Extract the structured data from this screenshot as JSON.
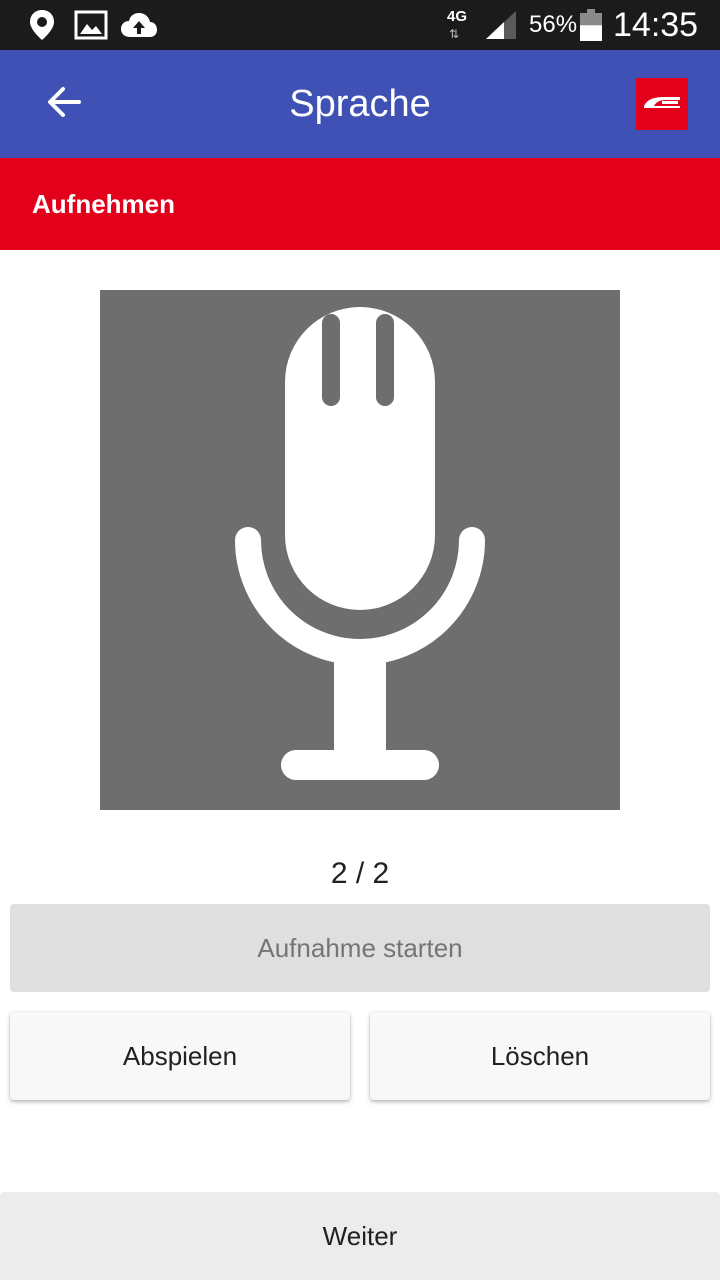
{
  "status_bar": {
    "icons": [
      "location-icon",
      "image-icon",
      "cloud-upload-icon"
    ],
    "network": "4G",
    "battery_percent": "56%",
    "battery_level": 0.56,
    "time": "14:35"
  },
  "app_bar": {
    "title": "Sprache",
    "back_icon": "arrow-back-icon",
    "logo_icon": "train-logo-icon",
    "color": "#3f51b5"
  },
  "section": {
    "label": "Aufnehmen",
    "color": "#e2001a"
  },
  "recorder": {
    "icon": "microphone-icon",
    "counter": "2 / 2",
    "record_button": "Aufnahme starten",
    "play_button": "Abspielen",
    "delete_button": "Löschen"
  },
  "footer": {
    "next_button": "Weiter"
  }
}
